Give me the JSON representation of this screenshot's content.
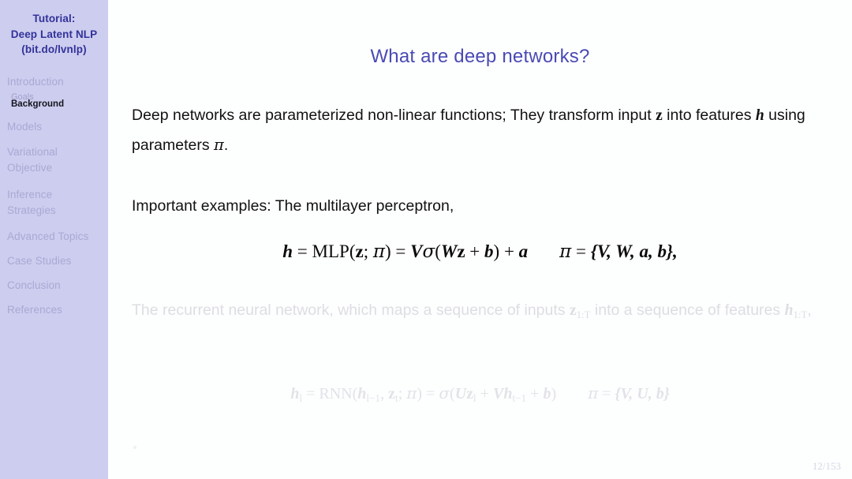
{
  "sidebar": {
    "header_lines": [
      "Tutorial:",
      "Deep Latent NLP",
      "(bit.do/lvnlp)"
    ],
    "items": [
      {
        "label": "Introduction",
        "label2": "",
        "type": "section"
      },
      {
        "label": "Goals",
        "type": "subsection",
        "current": false
      },
      {
        "label": "Background",
        "type": "subsection",
        "current": true
      },
      {
        "label": "Models",
        "label2": "",
        "type": "section"
      },
      {
        "label": "Variational",
        "label2": "Objective",
        "type": "section"
      },
      {
        "label": "Inference",
        "label2": "Strategies",
        "type": "section"
      },
      {
        "label": "Advanced Topics",
        "label2": "",
        "type": "section"
      },
      {
        "label": "Case Studies",
        "label2": "",
        "type": "section"
      },
      {
        "label": "Conclusion",
        "label2": "",
        "type": "section"
      },
      {
        "label": "References",
        "label2": "",
        "type": "section"
      }
    ]
  },
  "slide": {
    "title": "What are deep networks?",
    "paragraph_1": "Deep networks are parameterized non-linear functions; They transform input z into features h using parameters π.",
    "paragraph_1_parts": {
      "a": "Deep networks are parameterized non-linear functions; They transform input ",
      "z": "z",
      "b": " into features ",
      "h": "h",
      "c": " using parameters ",
      "pi": "π",
      "d": "."
    },
    "paragraph_2": "Important examples: The multilayer perceptron,",
    "equation_mlp": "h = MLP(z; π) = Vσ(Wz + b) + a      π = {V, W, a, b},",
    "equation_mlp_parts": {
      "lhs": "h",
      "eq1": " = ",
      "fn": "MLP",
      "open": "(",
      "z": "z",
      "semi": "; ",
      "pi": "π",
      "close": ")",
      "eq2": " = ",
      "V": "V",
      "sigma": "σ",
      "open2": "(",
      "W": "W",
      "z2": "z",
      "plus1": " + ",
      "b": "b",
      "close2": ")",
      "plus2": " + ",
      "a": "a",
      "pi2": "π",
      "eq3": " = ",
      "set": "{V, W, a, b},"
    },
    "paragraph_3": "The recurrent neural network, which maps a sequence of inputs z_{1:T} into a sequence of features h_{1:T},",
    "paragraph_3_parts": {
      "a": "The recurrent neural network, which maps a sequence of inputs ",
      "z": "z",
      "zsub": "1:T",
      "b": " into a sequence of features ",
      "h": "h",
      "hsub": "1:T",
      "c": ","
    },
    "equation_rnn": "h_l = RNN(h_{l−1}, z_t; π) = σ(Uz_l + Vh_{t−1} + b)      π = {V, U, b}",
    "equation_rnn_parts": {
      "h1": "h",
      "h1sub": "l",
      "eq1": " = ",
      "fn": "RNN",
      "open": "(",
      "h2": "h",
      "h2sub": "l−1",
      "comma": ", ",
      "z1": "z",
      "z1sub": "t",
      "semi": "; ",
      "pi": "π",
      "close": ")",
      "eq2": " = ",
      "sigma": "σ",
      "open2": "(",
      "U": "U",
      "z2": "z",
      "z2sub": "l",
      "plus1": " + ",
      "V": "V",
      "h3": "h",
      "h3sub": "t−1",
      "plus2": " + ",
      "b": "b",
      "close2": ")",
      "pi2": "π",
      "eq3": " = ",
      "set": "{V, U, b}"
    },
    "page_number": "12/153"
  },
  "colors": {
    "sidebar_bg": "#cdcdef",
    "sidebar_header_text": "#32329a",
    "sidebar_item_text": "#a8a8d4",
    "sidebar_current_text": "#14141e",
    "title_text": "#4a4ab4",
    "body_text": "#111111",
    "dim_text": "#dddde3",
    "page_number_text": "#d6d6e4",
    "main_bg": "#fdfffe"
  }
}
